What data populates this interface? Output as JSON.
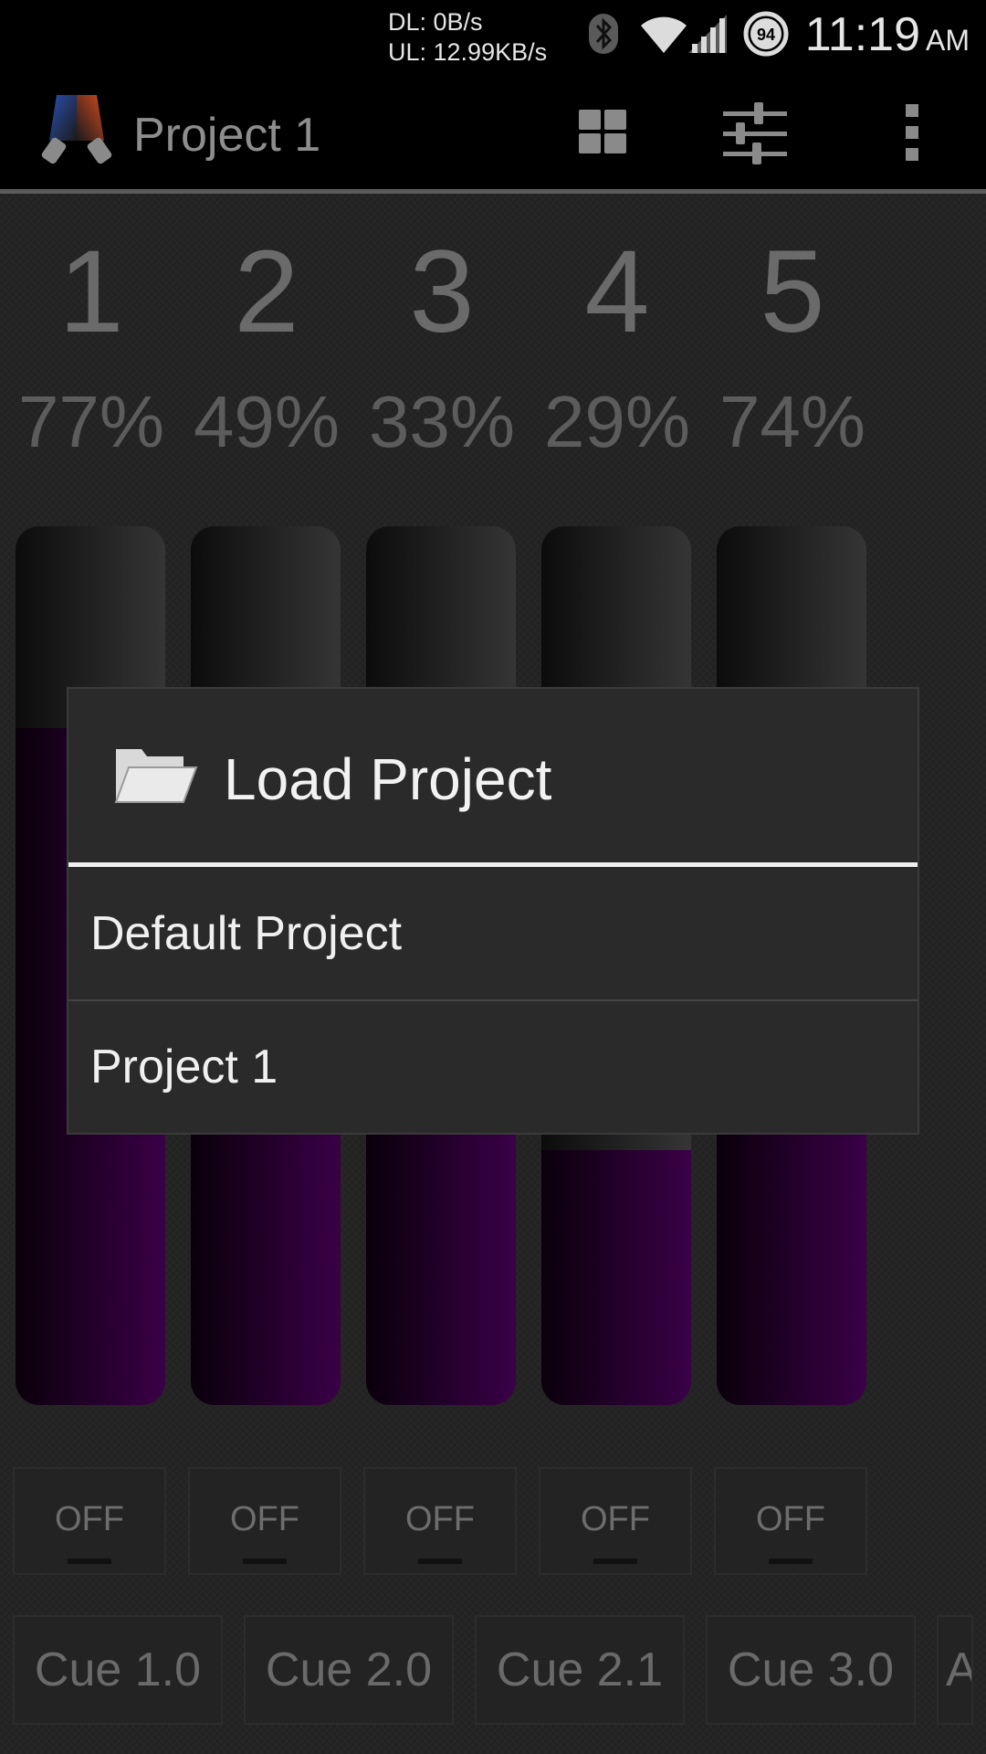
{
  "status_bar": {
    "download": "DL: 0B/s",
    "upload": "UL: 12.99KB/s",
    "battery_level": "94",
    "time": "11:19",
    "ampm": "AM",
    "icons": [
      "bluetooth-icon",
      "wifi-icon",
      "signal-icon",
      "battery-icon"
    ]
  },
  "action_bar": {
    "title": "Project 1",
    "actions": [
      "grid-view-icon",
      "sliders-icon",
      "overflow-menu-icon"
    ]
  },
  "channels": [
    {
      "number": "1",
      "percent": "77%",
      "level": 0.77
    },
    {
      "number": "2",
      "percent": "49%",
      "level": 0.49
    },
    {
      "number": "3",
      "percent": "33%",
      "level": 0.33
    },
    {
      "number": "4",
      "percent": "29%",
      "level": 0.29
    },
    {
      "number": "5",
      "percent": "74%",
      "level": 0.74
    }
  ],
  "off_buttons": [
    "OFF",
    "OFF",
    "OFF",
    "OFF",
    "OFF"
  ],
  "cues": [
    "Cue 1.0",
    "Cue 2.0",
    "Cue 2.1",
    "Cue 3.0",
    "A"
  ],
  "dialog": {
    "title": "Load Project",
    "icon": "folder-open-icon",
    "items": [
      "Default Project",
      "Project 1"
    ]
  },
  "colors": {
    "fader_fill": "#3a0047",
    "accent_line": "#f0f0f0"
  }
}
